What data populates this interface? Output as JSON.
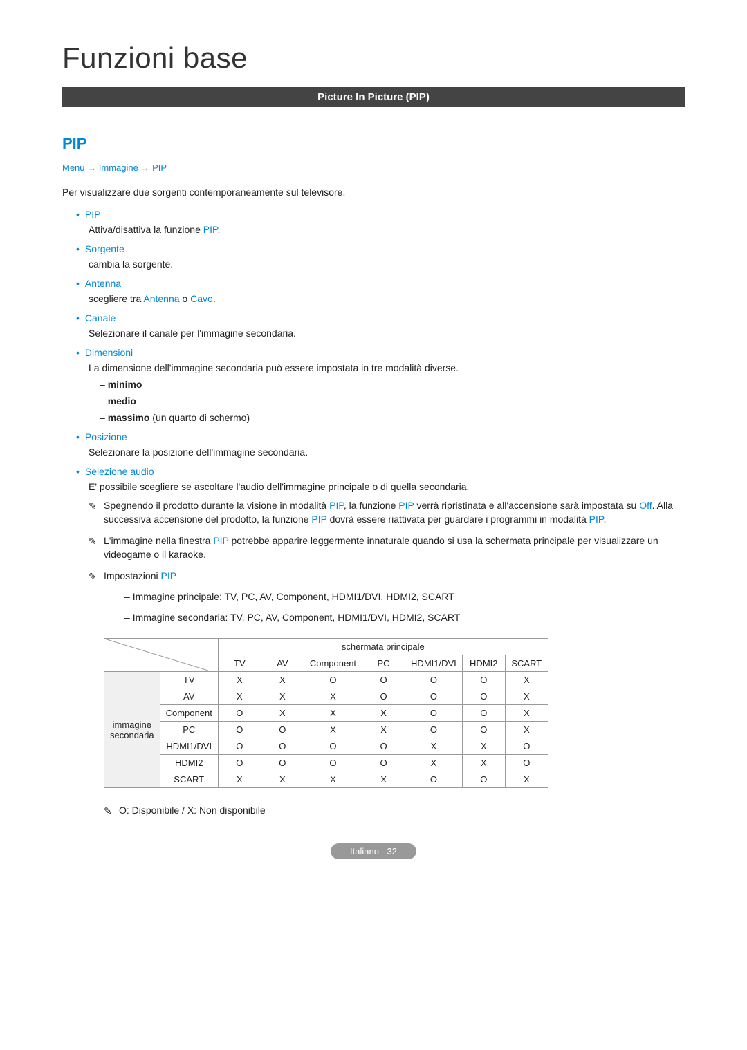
{
  "page_title": "Funzioni base",
  "section_bar": "Picture In Picture (PIP)",
  "heading": "PIP",
  "breadcrumb": {
    "p1": "Menu",
    "p2": "Immagine",
    "p3": "PIP",
    "arrow": "→"
  },
  "intro": "Per visualizzare due sorgenti contemporaneamente sul televisore.",
  "options": [
    {
      "label": "PIP",
      "desc_parts": [
        "Attiva/disattiva la funzione ",
        "PIP",
        "."
      ]
    },
    {
      "label": "Sorgente",
      "desc_parts": [
        "cambia la sorgente."
      ]
    },
    {
      "label": "Antenna",
      "desc_parts": [
        "scegliere tra ",
        "Antenna",
        " o ",
        "Cavo",
        "."
      ]
    },
    {
      "label": "Canale",
      "desc_parts": [
        "Selezionare il canale per l'immagine secondaria."
      ]
    },
    {
      "label": "Dimensioni",
      "desc_parts": [
        "La dimensione dell'immagine secondaria può essere impostata in tre modalità diverse."
      ],
      "sub": [
        {
          "bold": "minimo",
          "rest": ""
        },
        {
          "bold": "medio",
          "rest": ""
        },
        {
          "bold": "massimo",
          "rest": " (un quarto di schermo)"
        }
      ]
    },
    {
      "label": "Posizione",
      "desc_parts": [
        "Selezionare la posizione dell'immagine secondaria."
      ]
    },
    {
      "label": "Selezione audio",
      "desc_parts": [
        "E' possibile scegliere se ascoltare l'audio dell'immagine principale o di quella secondaria."
      ],
      "notes": [
        {
          "segments": [
            {
              "t": "Spegnendo il prodotto durante la visione in modalità "
            },
            {
              "t": "PIP",
              "hl": true
            },
            {
              "t": ", la funzione "
            },
            {
              "t": "PIP",
              "hl": true
            },
            {
              "t": " verrà ripristinata e all'accensione sarà impostata su "
            },
            {
              "t": "Off",
              "hl": true
            },
            {
              "t": ". Alla successiva accensione del prodotto, la funzione "
            },
            {
              "t": "PIP",
              "hl": true
            },
            {
              "t": " dovrà essere riattivata per guardare i programmi in modalità "
            },
            {
              "t": "PIP",
              "hl": true
            },
            {
              "t": "."
            }
          ]
        },
        {
          "segments": [
            {
              "t": "L'immagine nella finestra "
            },
            {
              "t": "PIP",
              "hl": true
            },
            {
              "t": " potrebbe apparire leggermente innaturale quando si usa la schermata principale per visualizzare un videogame o il karaoke."
            }
          ]
        }
      ],
      "settings_note": {
        "prefix": "Impostazioni ",
        "hl": "PIP",
        "sub": [
          "Immagine principale: TV, PC, AV, Component, HDMI1/DVI, HDMI2, SCART",
          "Immagine secondaria: TV, PC, AV, Component, HDMI1/DVI, HDMI2, SCART"
        ]
      }
    }
  ],
  "table": {
    "main_label": "schermata principale",
    "secondary_label": "immagine secondaria",
    "cols": [
      "TV",
      "AV",
      "Component",
      "PC",
      "HDMI1/DVI",
      "HDMI2",
      "SCART"
    ],
    "rows": [
      {
        "src": "TV",
        "cells": [
          "X",
          "X",
          "O",
          "O",
          "O",
          "O",
          "X"
        ]
      },
      {
        "src": "AV",
        "cells": [
          "X",
          "X",
          "X",
          "O",
          "O",
          "O",
          "X"
        ]
      },
      {
        "src": "Component",
        "cells": [
          "O",
          "X",
          "X",
          "X",
          "O",
          "O",
          "X"
        ]
      },
      {
        "src": "PC",
        "cells": [
          "O",
          "O",
          "X",
          "X",
          "O",
          "O",
          "X"
        ]
      },
      {
        "src": "HDMI1/DVI",
        "cells": [
          "O",
          "O",
          "O",
          "O",
          "X",
          "X",
          "O"
        ]
      },
      {
        "src": "HDMI2",
        "cells": [
          "O",
          "O",
          "O",
          "O",
          "X",
          "X",
          "O"
        ]
      },
      {
        "src": "SCART",
        "cells": [
          "X",
          "X",
          "X",
          "X",
          "O",
          "O",
          "X"
        ]
      }
    ]
  },
  "legend": "O: Disponibile / X: Non disponibile",
  "footer": "Italiano - 32"
}
